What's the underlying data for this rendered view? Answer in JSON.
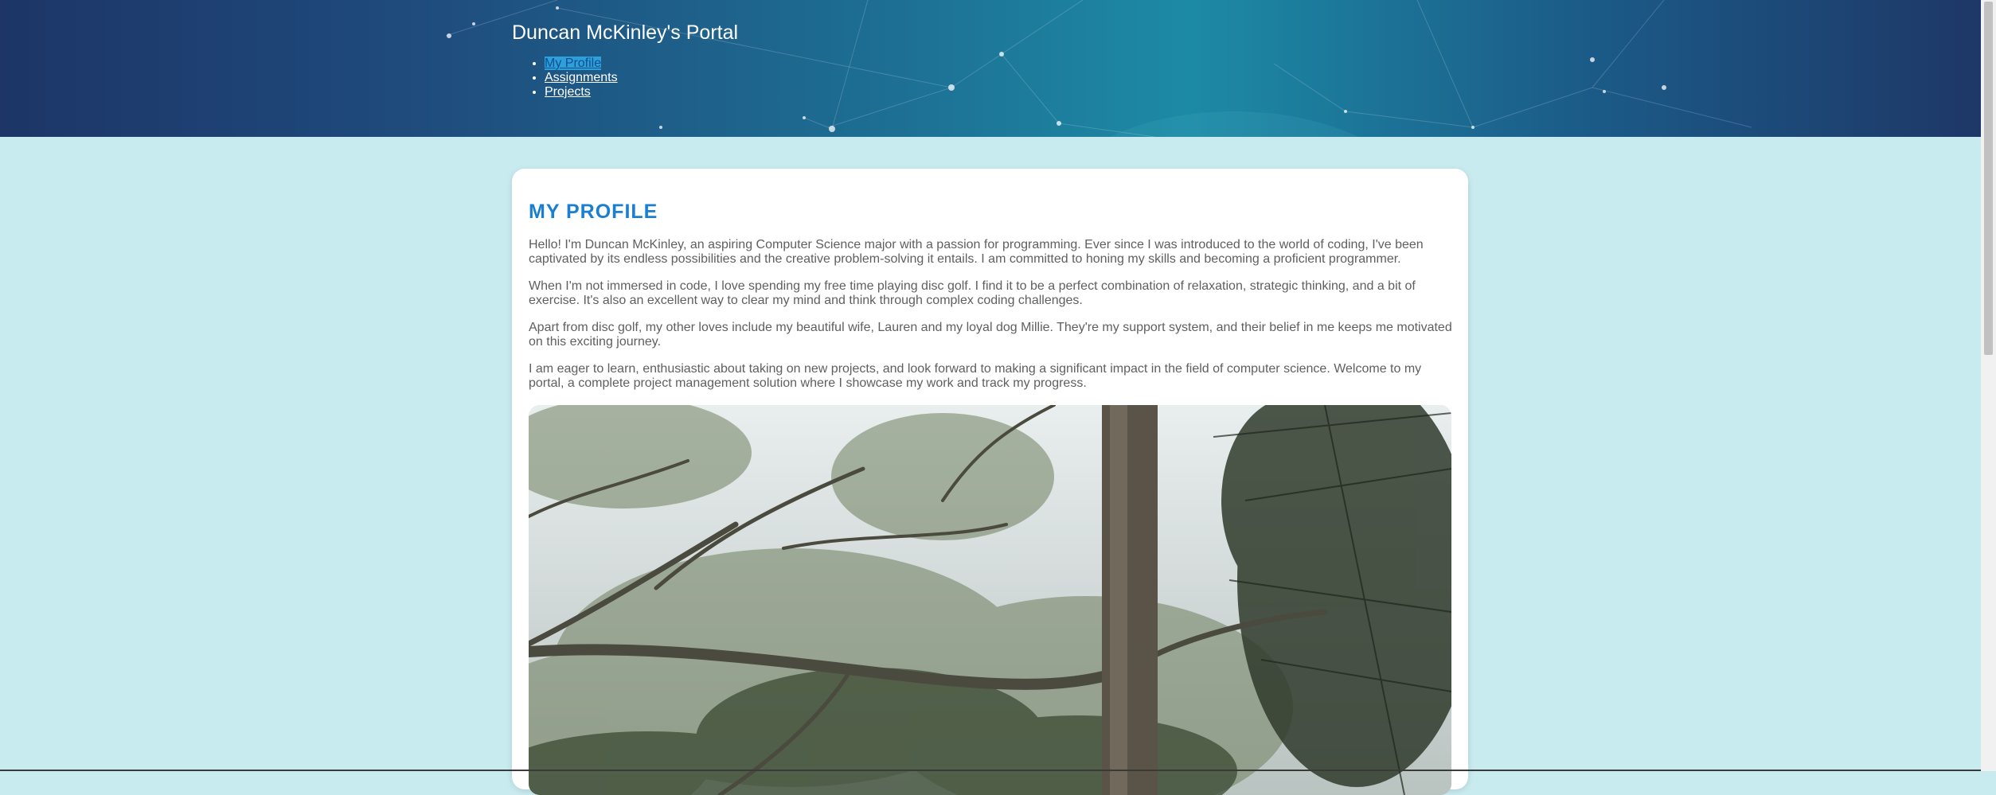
{
  "header": {
    "site_title": "Duncan McKinley's Portal",
    "nav": [
      {
        "label": "My Profile",
        "active": true
      },
      {
        "label": "Assignments",
        "active": false
      },
      {
        "label": "Projects",
        "active": false
      }
    ]
  },
  "main": {
    "heading": "MY PROFILE",
    "paragraphs": [
      "Hello! I'm Duncan McKinley, an aspiring Computer Science major with a passion for programming. Ever since I was introduced to the world of coding, I've been captivated by its endless possibilities and the creative problem-solving it entails. I am committed to honing my skills and becoming a proficient programmer.",
      "When I'm not immersed in code, I love spending my free time playing disc golf. I find it to be a perfect combination of relaxation, strategic thinking, and a bit of exercise. It's also an excellent way to clear my mind and think through complex coding challenges.",
      "Apart from disc golf, my other loves include my beautiful wife, Lauren and my loyal dog Millie. They're my support system, and their belief in me keeps me motivated on this exciting journey.",
      "I am eager to learn, enthusiastic about taking on new projects, and look forward to making a significant impact in the field of computer science. Welcome to my portal, a complete project management solution where I showcase my work and track my progress."
    ]
  },
  "colors": {
    "page_background": "#c8ebf0",
    "heading_accent": "#1a7fd1",
    "header_dark": "#1d3567",
    "header_teal": "#1d8aa5"
  }
}
